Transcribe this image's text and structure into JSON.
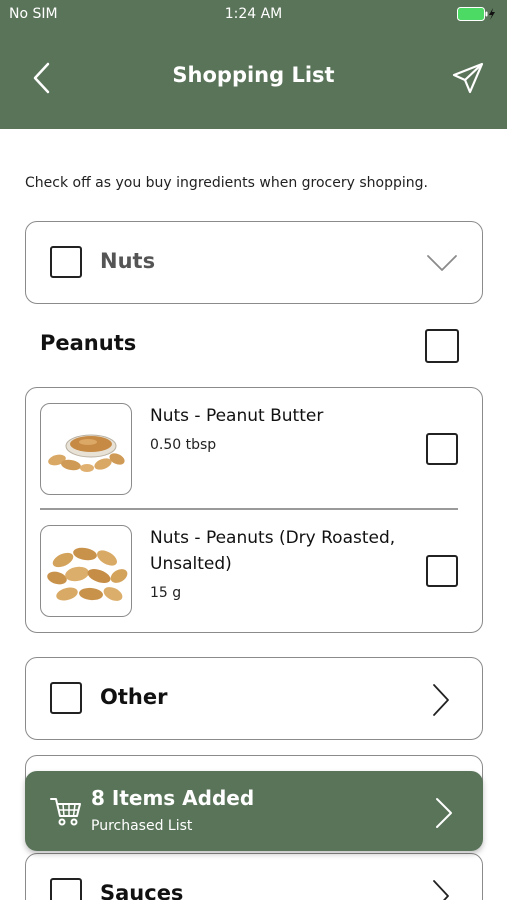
{
  "status_bar": {
    "carrier": "No SIM",
    "time": "1:24 AM"
  },
  "header": {
    "title": "Shopping List",
    "back_icon": "chevron-left-icon",
    "share_icon": "paper-plane-icon"
  },
  "instructions": "Check off as you buy ingredients when grocery shopping.",
  "categories": [
    {
      "label": "Nuts",
      "expanded": true,
      "checked": false
    },
    {
      "label": "Other",
      "expanded": false,
      "checked": false
    },
    {
      "label": "Sauces",
      "expanded": false,
      "checked": false
    }
  ],
  "group": {
    "label": "Peanuts",
    "checked": false,
    "items": [
      {
        "name": "Nuts - Peanut Butter",
        "quantity": "0.50 tbsp",
        "checked": false
      },
      {
        "name": "Nuts - Peanuts (Dry Roasted, Unsalted)",
        "quantity": "15 g",
        "checked": false
      }
    ]
  },
  "banner": {
    "title": "8 Items Added",
    "subtitle": "Purchased List",
    "icon": "shopping-cart-icon"
  },
  "colors": {
    "brand": "#5a7459",
    "battery": "#4cd964"
  }
}
